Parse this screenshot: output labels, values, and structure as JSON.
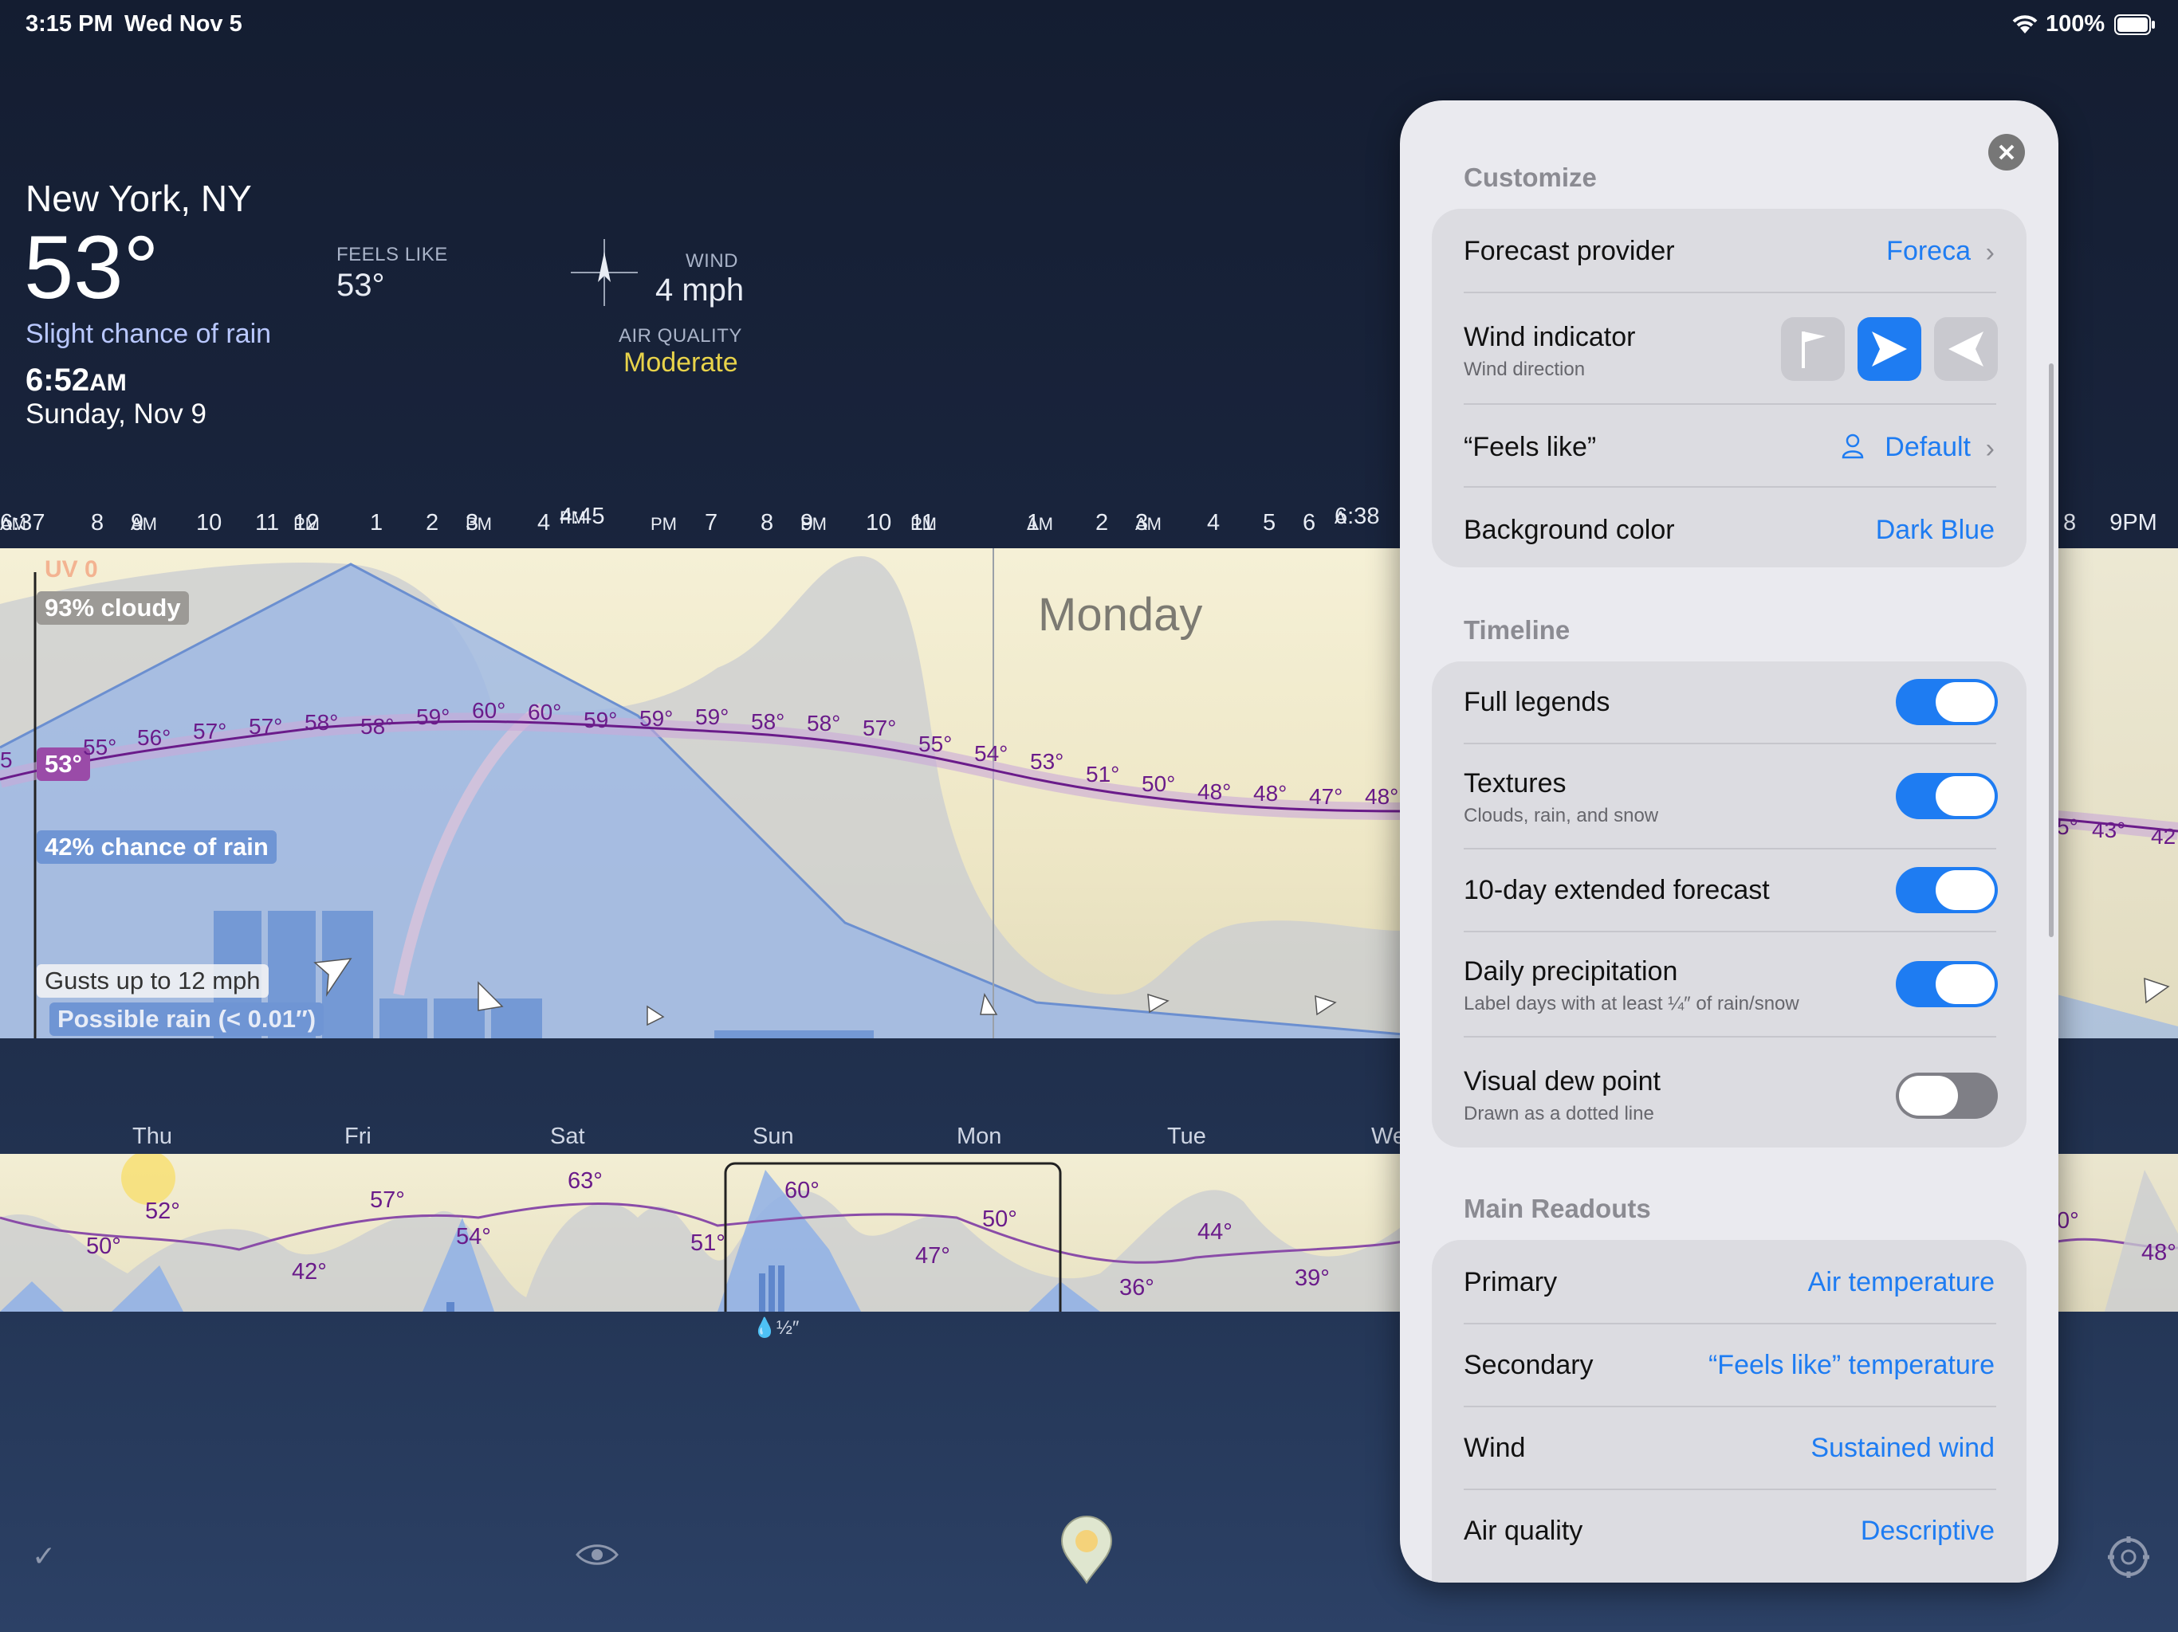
{
  "status_bar": {
    "time": "3:15 PM",
    "date": "Wed Nov 5",
    "battery": "100%"
  },
  "location": {
    "city": "New York, NY",
    "temperature": "53°",
    "summary": "Slight chance of rain",
    "time": "6:52",
    "time_period": "AM",
    "date": "Sunday, Nov 9",
    "feels_like_label": "FEELS LIKE",
    "feels_like_value": "53°",
    "wind_label": "WIND",
    "wind_value": "4 mph",
    "air_quality_label": "AIR QUALITY",
    "air_quality_value": "Moderate"
  },
  "hourly": {
    "axis_labels": [
      {
        "t": "6:37",
        "p": "AM"
      },
      {
        "t": "8",
        "p": ""
      },
      {
        "t": "9",
        "p": "AM"
      },
      {
        "t": "10",
        "p": ""
      },
      {
        "t": "11",
        "p": ""
      },
      {
        "t": "12",
        "p": "PM"
      },
      {
        "t": "1",
        "p": ""
      },
      {
        "t": "2",
        "p": ""
      },
      {
        "t": "3",
        "p": "PM"
      },
      {
        "t": "4",
        "p": ""
      },
      {
        "t": "4:45",
        "p": "PM"
      },
      {
        "t": "",
        "p": "PM"
      },
      {
        "t": "7",
        "p": ""
      },
      {
        "t": "8",
        "p": ""
      },
      {
        "t": "9",
        "p": "PM"
      },
      {
        "t": "10",
        "p": ""
      },
      {
        "t": "11",
        "p": "PM"
      },
      {
        "t": "1",
        "p": "AM"
      },
      {
        "t": "2",
        "p": ""
      },
      {
        "t": "3",
        "p": "AM"
      },
      {
        "t": "4",
        "p": ""
      },
      {
        "t": "5",
        "p": ""
      },
      {
        "t": "6",
        "p": ""
      },
      {
        "t": "6:38",
        "p": "A"
      }
    ],
    "right_axis_labels": [
      "8",
      "9PM"
    ],
    "day_label": "Monday",
    "uv": "UV 0",
    "cloud_cover": "93% cloudy",
    "current_temp": "53°",
    "rain_chance": "42% chance of rain",
    "gusts": "Gusts up to 12 mph",
    "possible_rain": "Possible rain (< 0.01″)",
    "temps": [
      "5",
      "55°",
      "56°",
      "57°",
      "57°",
      "58°",
      "58°",
      "59°",
      "60°",
      "60°",
      "59°",
      "59°",
      "59°",
      "58°",
      "58°",
      "57°",
      "55°",
      "54°",
      "53°",
      "51°",
      "50°",
      "48°",
      "48°",
      "47°",
      "48°"
    ],
    "right_temps": [
      "5°",
      "43°",
      "42"
    ]
  },
  "daily": {
    "days": [
      "Thu",
      "Fri",
      "Sat",
      "Sun",
      "Mon",
      "Tue",
      "We"
    ],
    "temps": [
      "52°",
      "50°",
      "57°",
      "42°",
      "63°",
      "54°",
      "51°",
      "60°",
      "47°",
      "50°",
      "36°",
      "44°",
      "39°"
    ],
    "right_temps": [
      "0°",
      "48°"
    ],
    "precip_label": "½″"
  },
  "toolbar": {
    "check": "✓"
  },
  "settings": {
    "customize_title": "Customize",
    "forecast_provider_label": "Forecast provider",
    "forecast_provider_value": "Foreca",
    "wind_indicator_label": "Wind indicator",
    "wind_indicator_sub": "Wind direction",
    "feels_like_label": "“Feels like”",
    "feels_like_value": "Default",
    "background_color_label": "Background color",
    "background_color_value": "Dark Blue",
    "timeline_title": "Timeline",
    "full_legends_label": "Full legends",
    "full_legends_on": true,
    "textures_label": "Textures",
    "textures_sub": "Clouds, rain, and snow",
    "textures_on": true,
    "extended_label": "10-day extended forecast",
    "extended_on": true,
    "daily_precip_label": "Daily precipitation",
    "daily_precip_sub": "Label days with at least ¼″ of rain/snow",
    "daily_precip_on": true,
    "dew_point_label": "Visual dew point",
    "dew_point_sub": "Drawn as a dotted line",
    "dew_point_on": false,
    "main_readouts_title": "Main Readouts",
    "primary_label": "Primary",
    "primary_value": "Air temperature",
    "secondary_label": "Secondary",
    "secondary_value": "“Feels like” temperature",
    "wind_label": "Wind",
    "wind_value": "Sustained wind",
    "air_quality_label": "Air quality",
    "air_quality_value": "Descriptive"
  },
  "colors": {
    "accent": "#1e7cf2",
    "temp_line": "#6a1b8a",
    "rain": "#8fb0e6",
    "air_quality": "#e8d34a"
  }
}
